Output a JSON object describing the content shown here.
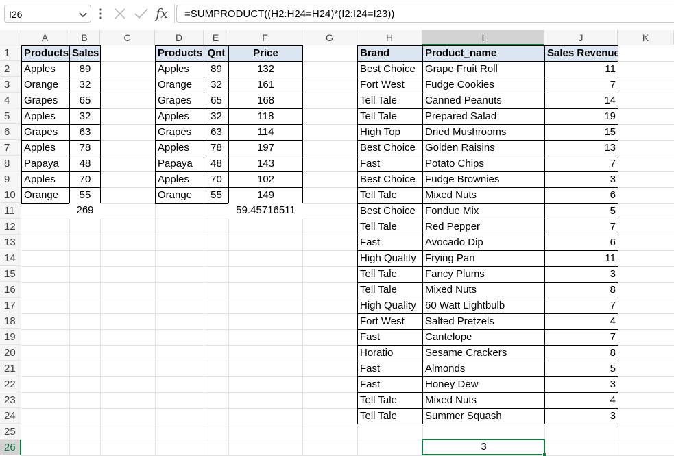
{
  "name_box": "I26",
  "formula": "=SUMPRODUCT((H2:H24=H24)*(I2:I24=I23))",
  "fx_label": "fx",
  "columns": [
    "A",
    "B",
    "C",
    "D",
    "E",
    "F",
    "G",
    "H",
    "I",
    "J",
    "K"
  ],
  "rows": [
    "1",
    "2",
    "3",
    "4",
    "5",
    "6",
    "7",
    "8",
    "9",
    "10",
    "11",
    "12",
    "13",
    "14",
    "15",
    "16",
    "17",
    "18",
    "19",
    "20",
    "21",
    "22",
    "23",
    "24",
    "25",
    "26"
  ],
  "table1": {
    "headers": [
      "Products",
      "Sales"
    ],
    "rows": [
      [
        "Apples",
        "89"
      ],
      [
        "Orange",
        "32"
      ],
      [
        "Grapes",
        "65"
      ],
      [
        "Apples",
        "32"
      ],
      [
        "Grapes",
        "63"
      ],
      [
        "Apples",
        "78"
      ],
      [
        "Papaya",
        "48"
      ],
      [
        "Apples",
        "70"
      ],
      [
        "Orange",
        "55"
      ]
    ],
    "total": "269"
  },
  "table2": {
    "headers": [
      "Products",
      "Qnt",
      "Price"
    ],
    "rows": [
      [
        "Apples",
        "89",
        "132"
      ],
      [
        "Orange",
        "32",
        "161"
      ],
      [
        "Grapes",
        "65",
        "168"
      ],
      [
        "Apples",
        "32",
        "118"
      ],
      [
        "Grapes",
        "63",
        "114"
      ],
      [
        "Apples",
        "78",
        "197"
      ],
      [
        "Papaya",
        "48",
        "143"
      ],
      [
        "Apples",
        "70",
        "102"
      ],
      [
        "Orange",
        "55",
        "149"
      ]
    ],
    "result": "59.45716511"
  },
  "table3": {
    "headers": [
      "Brand",
      "Product_name",
      "Sales Revenue"
    ],
    "rows": [
      [
        "Best Choice",
        "Grape Fruit Roll",
        "11"
      ],
      [
        "Fort West",
        "Fudge Cookies",
        "7"
      ],
      [
        "Tell Tale",
        "Canned Peanuts",
        "14"
      ],
      [
        "Tell Tale",
        "Prepared Salad",
        "19"
      ],
      [
        "High Top",
        "Dried Mushrooms",
        "15"
      ],
      [
        "Best Choice",
        "Golden Raisins",
        "13"
      ],
      [
        "Fast",
        "Potato Chips",
        "7"
      ],
      [
        "Best Choice",
        "Fudge Brownies",
        "3"
      ],
      [
        "Tell Tale",
        "Mixed Nuts",
        "6"
      ],
      [
        "Best Choice",
        "Fondue Mix",
        "5"
      ],
      [
        "Tell Tale",
        "Red Pepper",
        "7"
      ],
      [
        "Fast",
        "Avocado Dip",
        "6"
      ],
      [
        "High Quality",
        "Frying Pan",
        "11"
      ],
      [
        "Tell Tale",
        "Fancy Plums",
        "3"
      ],
      [
        "Tell Tale",
        "Mixed Nuts",
        "8"
      ],
      [
        "High Quality",
        "60 Watt Lightbulb",
        "7"
      ],
      [
        "Fort West",
        "Salted Pretzels",
        "4"
      ],
      [
        "Fast",
        "Cantelope",
        "7"
      ],
      [
        "Horatio",
        "Sesame Crackers",
        "8"
      ],
      [
        "Fast",
        "Almonds",
        "5"
      ],
      [
        "Fast",
        "Honey Dew",
        "3"
      ],
      [
        "Tell Tale",
        "Mixed Nuts",
        "4"
      ],
      [
        "Tell Tale",
        "Summer Squash",
        "3"
      ]
    ],
    "result": "3"
  },
  "colors": {
    "accent": "#107c41",
    "header_fill": "#dce6f2"
  }
}
